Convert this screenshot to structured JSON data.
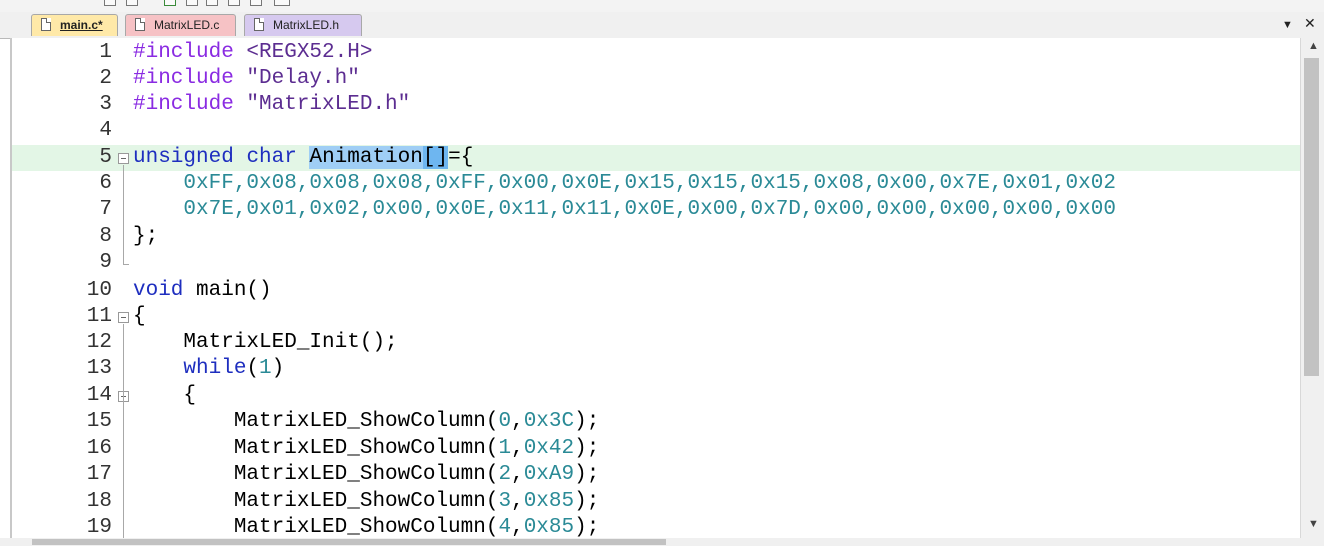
{
  "tabs": [
    {
      "label": "main.c*",
      "active": true,
      "color": "#ffe9a8"
    },
    {
      "label": "MatrixLED.c",
      "active": false,
      "color": "#f6c2c5"
    },
    {
      "label": "MatrixLED.h",
      "active": false,
      "color": "#d6c9ef"
    }
  ],
  "tab_controls": {
    "dropdown": "▼",
    "close": "✕"
  },
  "editor": {
    "line_numbers": [
      "1",
      "2",
      "3",
      "4",
      "5",
      "6",
      "7",
      "8",
      "9",
      "10",
      "11",
      "12",
      "13",
      "14",
      "15",
      "16",
      "17",
      "18",
      "19"
    ],
    "highlighted_line": "5",
    "lines": {
      "l1": [
        "#include ",
        "<REGX52.H>"
      ],
      "l2": [
        "#include ",
        "\"Delay.h\""
      ],
      "l3": [
        "#include ",
        "\"MatrixLED.h\""
      ],
      "l5": [
        "unsigned",
        " ",
        "char",
        " ",
        "Animation",
        "[]",
        "={"
      ],
      "l6": "    0xFF,0x08,0x08,0x08,0xFF,0x00,0x0E,0x15,0x15,0x15,0x08,0x00,0x7E,0x01,0x02",
      "l7": "    0x7E,0x01,0x02,0x00,0x0E,0x11,0x11,0x0E,0x00,0x7D,0x00,0x00,0x00,0x00,0x00",
      "l8": "};",
      "l10": [
        "void",
        " main()"
      ],
      "l11": "{",
      "l12": "    MatrixLED_Init();",
      "l13": [
        "    ",
        "while",
        "(",
        "1",
        ")"
      ],
      "l14": "    {",
      "l15": [
        "        MatrixLED_ShowColumn(",
        "0",
        ",",
        "0x3C",
        ");"
      ],
      "l16": [
        "        MatrixLED_ShowColumn(",
        "1",
        ",",
        "0x42",
        ");"
      ],
      "l17": [
        "        MatrixLED_ShowColumn(",
        "2",
        ",",
        "0xA9",
        ");"
      ],
      "l18": [
        "        MatrixLED_ShowColumn(",
        "3",
        ",",
        "0x85",
        ");"
      ],
      "l19": [
        "        MatrixLED_ShowColumn(",
        "4",
        ",",
        "0x85",
        ");"
      ]
    }
  },
  "scrollbar": {
    "up": "▲",
    "down": "▼"
  },
  "colors": {
    "keyword": "#1e2ebf",
    "number": "#2a8a96",
    "preprocessor": "#8a2be2",
    "selection": "#9fcef5",
    "current_line": "#e3f6e6"
  }
}
